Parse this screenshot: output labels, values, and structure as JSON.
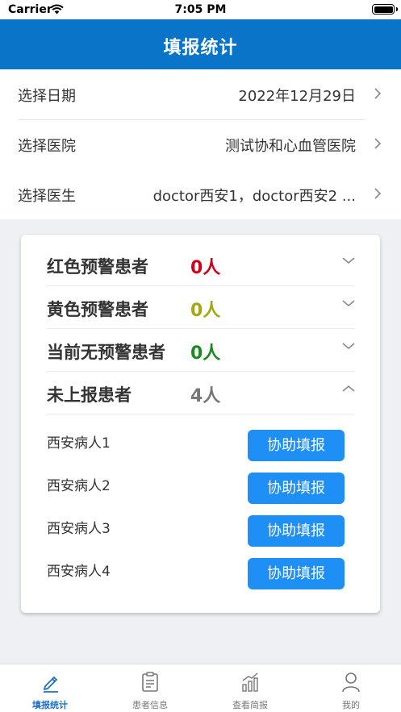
{
  "status_bar": {
    "carrier": "Carrier",
    "time": "7:05 PM"
  },
  "header": {
    "title": "填报统计"
  },
  "selectors": [
    {
      "label": "选择日期",
      "value": "2022年12月29日"
    },
    {
      "label": "选择医院",
      "value": "测试协和心血管医院"
    },
    {
      "label": "选择医生",
      "value": "doctor西安1，doctor西安2 ..."
    }
  ],
  "groups": [
    {
      "label": "红色预警患者",
      "count": "0人",
      "color": "#d0021b",
      "expanded": false
    },
    {
      "label": "黄色预警患者",
      "count": "0人",
      "color": "#a3a80c",
      "expanded": false
    },
    {
      "label": "当前无预警患者",
      "count": "0人",
      "color": "#1a8a1a",
      "expanded": false
    },
    {
      "label": "未上报患者",
      "count": "4人",
      "color": "#777777",
      "expanded": true
    }
  ],
  "patients": [
    {
      "name": "西安病人1",
      "action": "协助填报"
    },
    {
      "name": "西安病人2",
      "action": "协助填报"
    },
    {
      "name": "西安病人3",
      "action": "协助填报"
    },
    {
      "name": "西安病人4",
      "action": "协助填报"
    }
  ],
  "tabbar": [
    {
      "label": "填报统计",
      "icon": "edit-icon",
      "active": true
    },
    {
      "label": "患者信息",
      "icon": "clipboard-icon",
      "active": false
    },
    {
      "label": "查看简报",
      "icon": "bar-chart-icon",
      "active": false
    },
    {
      "label": "我的",
      "icon": "person-icon",
      "active": false
    }
  ],
  "colors": {
    "primary": "#0a74c9",
    "button": "#1e8ff5",
    "tab_active": "#1a6fd0"
  }
}
